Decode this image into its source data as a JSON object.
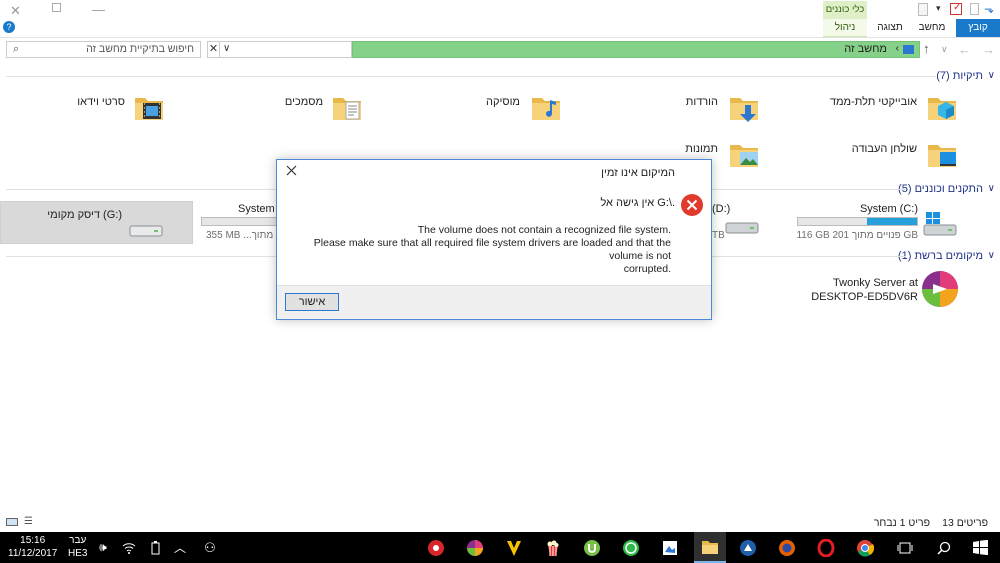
{
  "ribbon": {
    "contextual_group": "כלי כוננים",
    "contextual_tab": "ניהול",
    "tabs": [
      "תצוגה",
      "מחשב",
      "קובץ"
    ]
  },
  "address": {
    "path": "מחשב זה",
    "search_placeholder": "חיפוש בתיקיית מחשב זה"
  },
  "folders": {
    "header": "תיקיות (7)",
    "items": [
      {
        "label": "אובייקטי תלת-ממד",
        "icon": "3d-objects-folder-icon"
      },
      {
        "label": "הורדות",
        "icon": "downloads-folder-icon"
      },
      {
        "label": "מוסיקה",
        "icon": "music-folder-icon"
      },
      {
        "label": "מסמכים",
        "icon": "documents-folder-icon"
      },
      {
        "label": "סרטי וידאו",
        "icon": "videos-folder-icon"
      },
      {
        "label": "שולחן העבודה",
        "icon": "desktop-folder-icon"
      },
      {
        "label": "תמונות",
        "icon": "pictures-folder-icon"
      }
    ]
  },
  "drives": {
    "header": "התקנים וכוננים (5)",
    "items": [
      {
        "label": "System (C:)",
        "free": "116 GB פנויים מתוך 201 GB",
        "used_fraction": 0.42
      },
      {
        "label": "(D:)",
        "free": "TB",
        "used_fraction": 0.0
      },
      {
        "label": "System R",
        "free": "355 MB ...יים מתוך",
        "used_fraction": 0.2
      },
      {
        "label": "דיסק מקומי (G:)",
        "free": "",
        "used_fraction": 0.0
      }
    ]
  },
  "network": {
    "header": "מיקומים ברשת (1)",
    "items": [
      {
        "label_line1": "Twonky Server at",
        "label_line2": "DESKTOP-ED5DV6R"
      }
    ]
  },
  "dialog": {
    "title": "המיקום אינו זמין",
    "heading": "אין גישה אל G:\\.",
    "line1": "The volume does not contain a recognized file system.",
    "line2": "Please make sure that all required file system drivers are loaded and that the volume is not",
    "line3": "corrupted.",
    "ok_label": "אישור"
  },
  "status": {
    "items_count": "13 פריטים",
    "selected": "פריט 1 נבחר"
  },
  "taskbar": {
    "time": "15:16",
    "date": "11/12/2017",
    "lang_line1": "עבר",
    "lang_line2": "HE3"
  },
  "colors": {
    "address_bar": "#86d18a",
    "accent": "#1979ca",
    "header_text": "#1e3287",
    "drive_fill": "#26a0da",
    "error_red": "#e81123"
  }
}
